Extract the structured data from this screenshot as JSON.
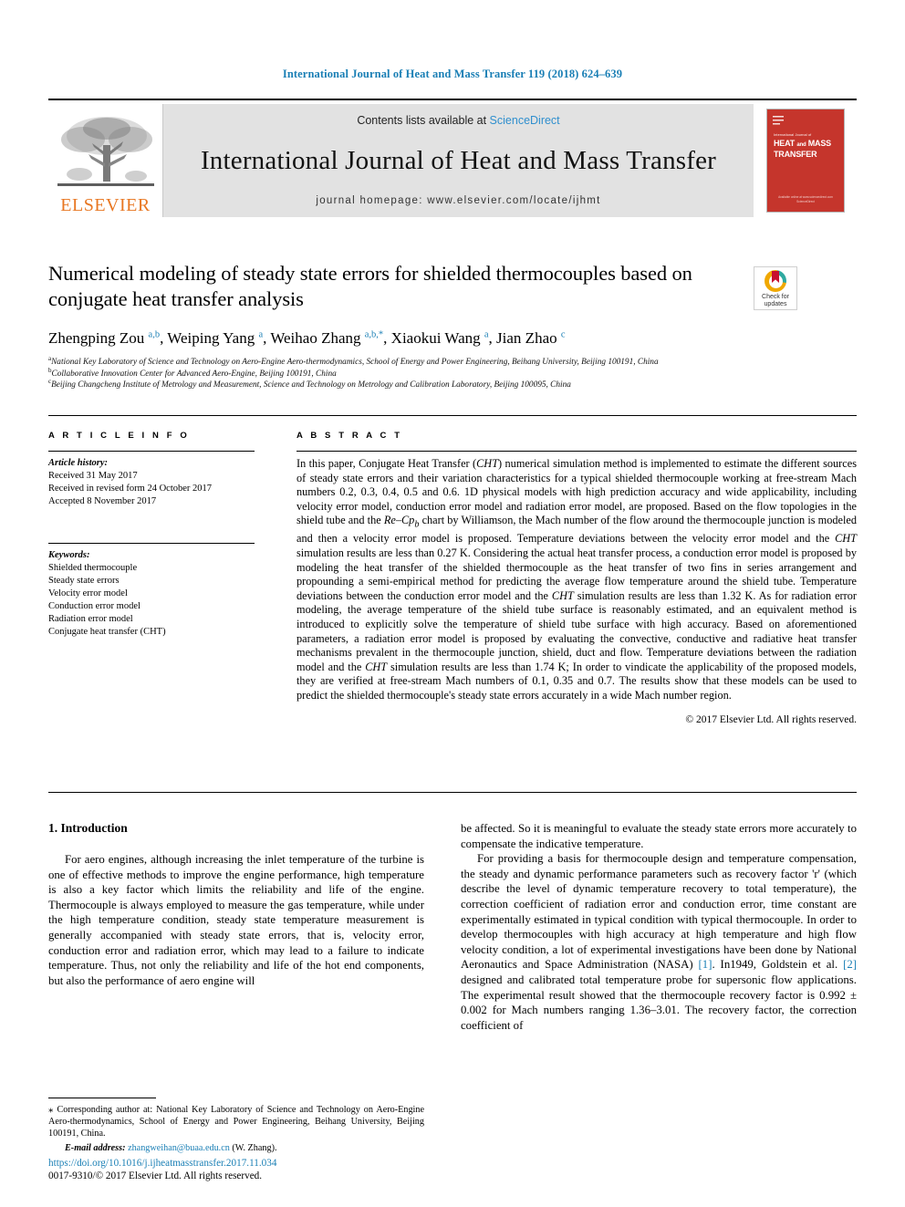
{
  "running_head": "International Journal of Heat and Mass Transfer 119 (2018) 624–639",
  "masthead": {
    "elsevier_wordmark": "ELSEVIER",
    "contents_prefix": "Contents lists available at ",
    "sciencedirect": "ScienceDirect",
    "journal_title": "International Journal of Heat and Mass Transfer",
    "homepage": "journal homepage: www.elsevier.com/locate/ijhmt",
    "cover": {
      "supertitle": "International Journal of",
      "title_line1": "HEAT",
      "title_and": "and",
      "title_line1b": "MASS",
      "title_line2": "TRANSFER",
      "footer1": "Available online at www.sciencedirect.com",
      "footer2": "ScienceDirect"
    },
    "colors": {
      "link": "#2f8fce",
      "cover_red": "#c5352c",
      "elsevier_orange": "#e87722",
      "band_gray": "#e2e2e2"
    }
  },
  "crossmark": {
    "line1": "Check for",
    "line2": "updates"
  },
  "article": {
    "title": "Numerical modeling of steady state errors for shielded thermocouples based on conjugate heat transfer analysis",
    "authors_html": "Zhengping Zou <sup>a,b</sup>, Weiping Yang <sup>a</sup>, Weihao Zhang <sup>a,b,*</sup>, Xiaokui Wang <sup>a</sup>, Jian Zhao <sup>c</sup>",
    "affiliations": [
      {
        "marker": "a",
        "text": "National Key Laboratory of Science and Technology on Aero-Engine Aero-thermodynamics, School of Energy and Power Engineering, Beihang University, Beijing 100191, China"
      },
      {
        "marker": "b",
        "text": "Collaborative Innovation Center for Advanced Aero-Engine, Beijing 100191, China"
      },
      {
        "marker": "c",
        "text": "Beijing Changcheng Institute of Metrology and Measurement, Science and Technology on Metrology and Calibration Laboratory, Beijing 100095, China"
      }
    ]
  },
  "headings": {
    "article_info": "A R T I C L E   I N F O",
    "abstract": "A B S T R A C T"
  },
  "article_info": {
    "history_label": "Article history:",
    "history": [
      "Received 31 May 2017",
      "Received in revised form 24 October 2017",
      "Accepted 8 November 2017"
    ],
    "keywords_label": "Keywords:",
    "keywords": [
      "Shielded thermocouple",
      "Steady state errors",
      "Velocity error model",
      "Conduction error model",
      "Radiation error model",
      "Conjugate heat transfer (CHT)"
    ]
  },
  "abstract": {
    "paragraph_html": "In this paper, Conjugate Heat Transfer (<i>CHT</i>) numerical simulation method is implemented to estimate the different sources of steady state errors and their variation characteristics for a typical shielded thermocouple working at free-stream Mach numbers 0.2, 0.3, 0.4, 0.5 and 0.6. 1D physical models with high prediction accuracy and wide applicability, including velocity error model, conduction error model and radiation error model, are proposed. Based on the flow topologies in the shield tube and the <i>Re–Cp<sub>b</sub></i> chart by Williamson, the Mach number of the flow around the thermocouple junction is modeled and then a velocity error model is proposed. Temperature deviations between the velocity error model and the <i>CHT</i> simulation results are less than 0.27 K. Considering the actual heat transfer process, a conduction error model is proposed by modeling the heat transfer of the shielded thermocouple as the heat transfer of two fins in series arrangement and propounding a semi-empirical method for predicting the average flow temperature around the shield tube. Temperature deviations between the conduction error model and the <i>CHT</i> simulation results are less than 1.32 K. As for radiation error modeling, the average temperature of the shield tube surface is reasonably estimated, and an equivalent method is introduced to explicitly solve the temperature of shield tube surface with high accuracy. Based on aforementioned parameters, a radiation error model is proposed by evaluating the convective, conductive and radiative heat transfer mechanisms prevalent in the thermocouple junction, shield, duct and flow. Temperature deviations between the radiation model and the <i>CHT</i> simulation results are less than 1.74 K; In order to vindicate the applicability of the proposed models, they are verified at free-stream Mach numbers of 0.1, 0.35 and 0.7. The results show that these models can be used to predict the shielded thermocouple's steady state errors accurately in a wide Mach number region.",
    "copyright": "© 2017 Elsevier Ltd. All rights reserved."
  },
  "body": {
    "section_number_title": "1. Introduction",
    "left_paragraph": "For aero engines, although increasing the inlet temperature of the turbine is one of effective methods to improve the engine performance, high temperature is also a key factor which limits the reliability and life of the engine. Thermocouple is always employed to measure the gas temperature, while under the high temperature condition, steady state temperature measurement is generally accompanied with steady state errors, that is, velocity error, conduction error and radiation error, which may lead to a failure to indicate temperature. Thus, not only the reliability and life of the hot end components, but also the performance of aero engine will",
    "right_paragraph_1": "be affected. So it is meaningful to evaluate the steady state errors more accurately to compensate the indicative temperature.",
    "right_paragraph_2_html": "For providing a basis for thermocouple design and temperature compensation, the steady and dynamic performance parameters such as recovery factor 'r' (which describe the level of dynamic temperature recovery to total temperature), the correction coefficient of radiation error and conduction error, time constant are experimentally estimated in typical condition with typical thermocouple. In order to develop thermocouples with high accuracy at high temperature and high flow velocity condition, a lot of experimental investigations have been done by National Aeronautics and Space Administration (NASA) <span class=\"ref-link\">[1]</span>. In1949, Goldstein et al. <span class=\"ref-link\">[2]</span> designed and calibrated total temperature probe for supersonic flow applications. The experimental result showed that the thermocouple recovery factor is 0.992 ± 0.002 for Mach numbers ranging 1.36–3.01. The recovery factor, the correction coefficient of"
  },
  "footnote": {
    "corresponding_html": "<span class=\"star\">⁎</span> Corresponding author at: National Key Laboratory of Science and Technology on Aero-Engine Aero-thermodynamics, School of Energy and Power Engineering, Beihang University, Beijing 100191, China.",
    "email_label": "E-mail address:",
    "email": "zhangweihan@buaa.edu.cn",
    "email_suffix": "(W. Zhang)."
  },
  "doi": {
    "url": "https://doi.org/10.1016/j.ijheatmasstransfer.2017.11.034",
    "issn_line": "0017-9310/© 2017 Elsevier Ltd. All rights reserved."
  }
}
